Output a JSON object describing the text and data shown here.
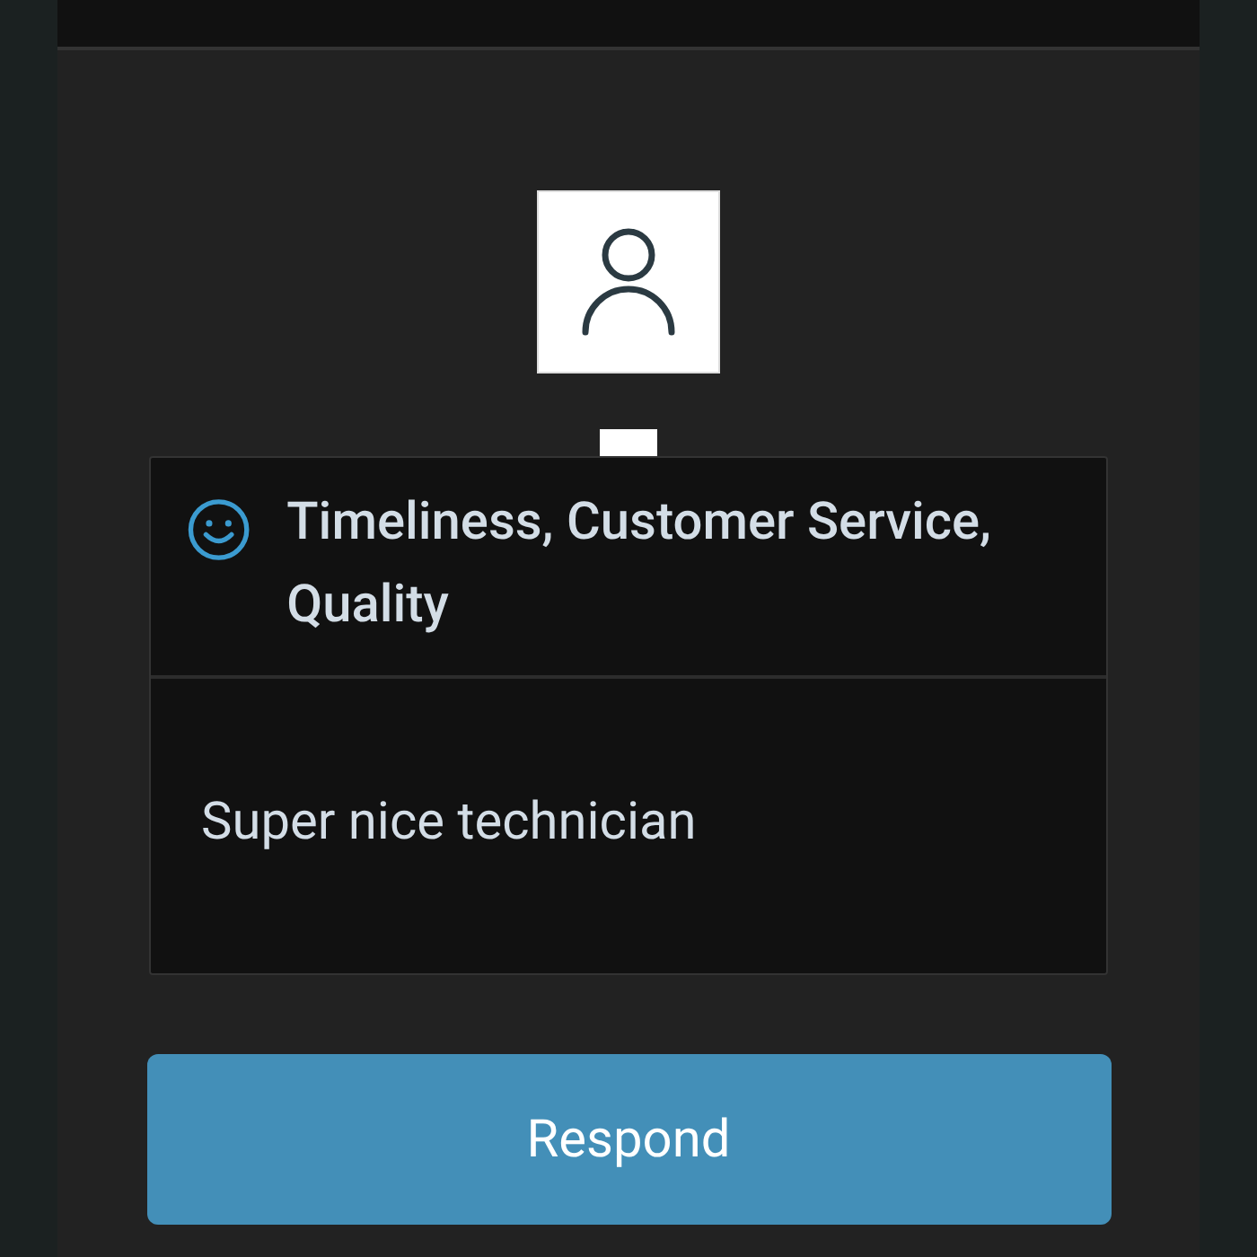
{
  "review": {
    "categories": "Timeliness, Customer Service, Quality",
    "comment": "Super nice technician"
  },
  "actions": [
    {
      "label": "Respond"
    }
  ]
}
